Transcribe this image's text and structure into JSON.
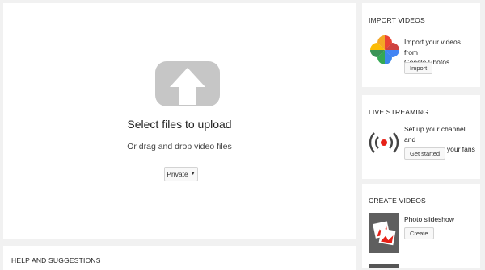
{
  "upload": {
    "title": "Select files to upload",
    "subtitle": "Or drag and drop video files",
    "privacy_value": "Private"
  },
  "help": {
    "title": "HELP AND SUGGESTIONS"
  },
  "import": {
    "title": "IMPORT VIDEOS",
    "text_line1": "Import your videos from",
    "text_line2": "Google Photos",
    "button": "Import",
    "icon": "google-photos-icon"
  },
  "live": {
    "title": "LIVE STREAMING",
    "text_line1": "Set up your channel and",
    "text_line2": "stream live to your fans",
    "button": "Get started",
    "icon": "live-broadcast-icon"
  },
  "create": {
    "title": "CREATE VIDEOS",
    "item_label": "Photo slideshow",
    "button": "Create",
    "icon": "photo-slideshow-icon"
  },
  "colors": {
    "upload_icon": "#c6c6c6",
    "live_red": "#e62117",
    "panel_bg": "#ffffff",
    "page_bg": "#f1f1f1"
  }
}
